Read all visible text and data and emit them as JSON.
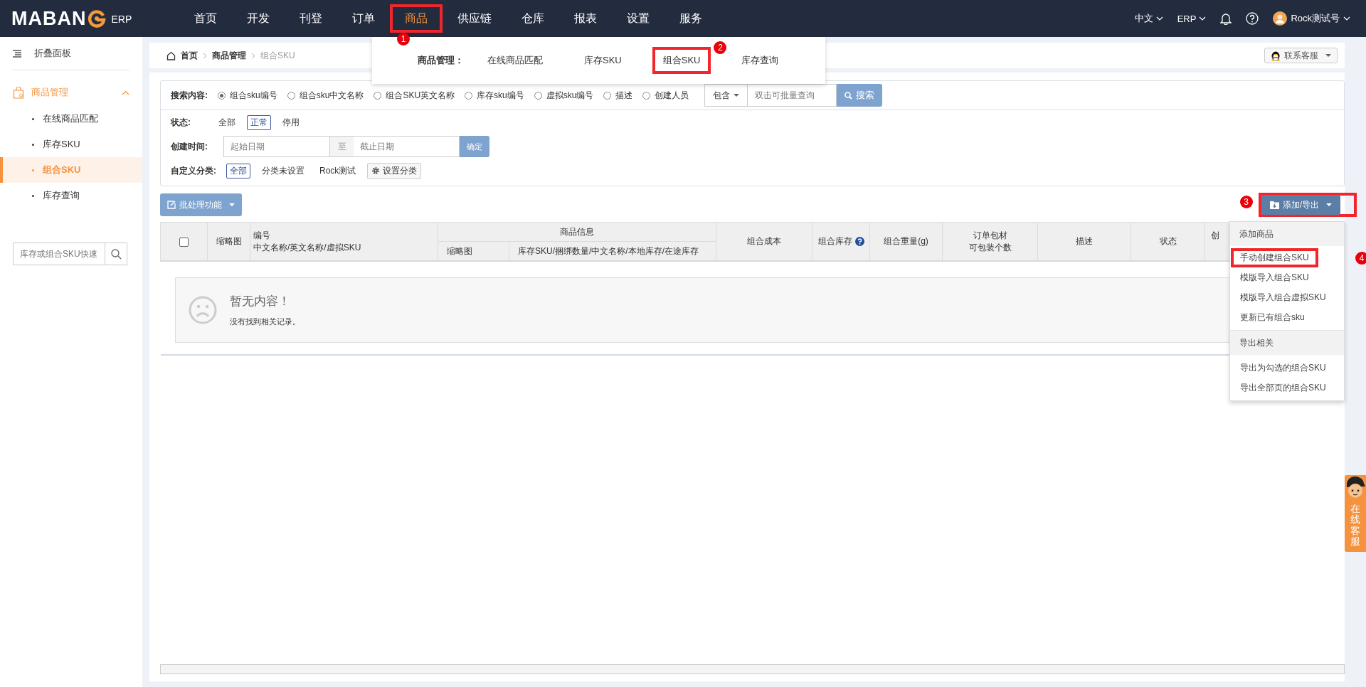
{
  "top_nav": {
    "logo": "MABAN",
    "logo_suffix": "ERP",
    "items": [
      {
        "label": "首页",
        "selected": false,
        "boxed": false
      },
      {
        "label": "开发",
        "selected": false,
        "boxed": false
      },
      {
        "label": "刊登",
        "selected": false,
        "boxed": false
      },
      {
        "label": "订单",
        "selected": false,
        "boxed": false
      },
      {
        "label": "商品",
        "selected": true,
        "boxed": true,
        "marker": "1"
      },
      {
        "label": "供应链",
        "selected": false,
        "boxed": false
      },
      {
        "label": "仓库",
        "selected": false,
        "boxed": false
      },
      {
        "label": "报表",
        "selected": false,
        "boxed": false
      },
      {
        "label": "设置",
        "selected": false,
        "boxed": false
      },
      {
        "label": "服务",
        "selected": false,
        "boxed": false
      }
    ],
    "language": "中文",
    "system": "ERP",
    "user": "Rock测试号"
  },
  "nav_dropdown": {
    "heading": "商品管理：",
    "items": [
      {
        "label": "在线商品匹配",
        "boxed": false
      },
      {
        "label": "库存SKU",
        "boxed": false
      },
      {
        "label": "组合SKU",
        "boxed": true,
        "marker": "2"
      },
      {
        "label": "库存查询",
        "boxed": false
      }
    ]
  },
  "sidebar": {
    "collapse_label": "折叠面板",
    "section": {
      "label": "商品管理",
      "expanded": true,
      "items": [
        {
          "label": "在线商品匹配",
          "selected": false
        },
        {
          "label": "库存SKU",
          "selected": false
        },
        {
          "label": "组合SKU",
          "selected": true
        },
        {
          "label": "库存查询",
          "selected": false
        }
      ]
    },
    "search_placeholder": "库存或组合SKU快速"
  },
  "breadcrumb": [
    "首页",
    "商品管理",
    "组合SKU"
  ],
  "contact_button": "联系客服",
  "filters": {
    "search_label": "搜索内容:",
    "search_options": [
      {
        "label": "组合sku编号",
        "selected": true
      },
      {
        "label": "组合sku中文名称",
        "selected": false
      },
      {
        "label": "组合SKU英文名称",
        "selected": false
      },
      {
        "label": "库存sku编号",
        "selected": false
      },
      {
        "label": "虚拟sku编号",
        "selected": false
      },
      {
        "label": "描述",
        "selected": false
      },
      {
        "label": "创建人员",
        "selected": false
      }
    ],
    "match_mode": "包含",
    "query_placeholder": "双击可批量查询",
    "search_button": "搜索",
    "status_label": "状态:",
    "status_options": [
      {
        "label": "全部",
        "selected": false
      },
      {
        "label": "正常",
        "selected": true
      },
      {
        "label": "停用",
        "selected": false
      }
    ],
    "date_label": "创建时间:",
    "start_placeholder": "起始日期",
    "date_separator": "至",
    "end_placeholder": "截止日期",
    "confirm_button": "确定",
    "category_label": "自定义分类:",
    "category_options": [
      {
        "label": "全部",
        "selected": true
      },
      {
        "label": "分类未设置",
        "selected": false
      },
      {
        "label": "Rock测试",
        "selected": false
      }
    ],
    "category_settings": "设置分类"
  },
  "batch_button": "批处理功能",
  "add_export_button": {
    "label": "添加/导出",
    "boxed": true,
    "marker": "3"
  },
  "table": {
    "columns": [
      {
        "kind": "checkbox",
        "checked": false
      },
      {
        "kind": "text",
        "label": "缩略图"
      },
      {
        "kind": "lines",
        "lines": [
          "编号",
          "中文名称/英文名称/虚拟SKU"
        ]
      },
      {
        "kind": "group",
        "label": "商品信息",
        "children": [
          {
            "label": "缩略图"
          },
          {
            "label": "库存SKU/捆绑数量/中文名称/本地库存/在途库存"
          }
        ]
      },
      {
        "kind": "text",
        "label": "组合成本"
      },
      {
        "kind": "text",
        "label": "组合库存",
        "help": true
      },
      {
        "kind": "text",
        "label": "组合重量(g)"
      },
      {
        "kind": "lines",
        "lines": [
          "订单包材",
          "可包装个数"
        ]
      },
      {
        "kind": "text",
        "label": "描述"
      },
      {
        "kind": "text",
        "label": "状态"
      },
      {
        "kind": "cut",
        "label": "创"
      }
    ],
    "empty_title": "暂无内容！",
    "empty_text": "没有找到相关记录。"
  },
  "add_menu": {
    "items": [
      {
        "kind": "header",
        "label": "添加商品"
      },
      {
        "kind": "item",
        "label": "手动创建组合SKU",
        "boxed": true,
        "marker": "4"
      },
      {
        "kind": "item",
        "label": "模版导入组合SKU",
        "boxed": false
      },
      {
        "kind": "item",
        "label": "模版导入组合虚拟SKU",
        "boxed": false
      },
      {
        "kind": "item",
        "label": "更新已有组合sku",
        "boxed": false
      },
      {
        "kind": "header",
        "label": "导出相关"
      },
      {
        "kind": "item",
        "label": "导出为勾选的组合SKU",
        "boxed": false
      },
      {
        "kind": "item",
        "label": "导出全部页的组合SKU",
        "boxed": false
      }
    ]
  },
  "chat_tab": "在线客服"
}
